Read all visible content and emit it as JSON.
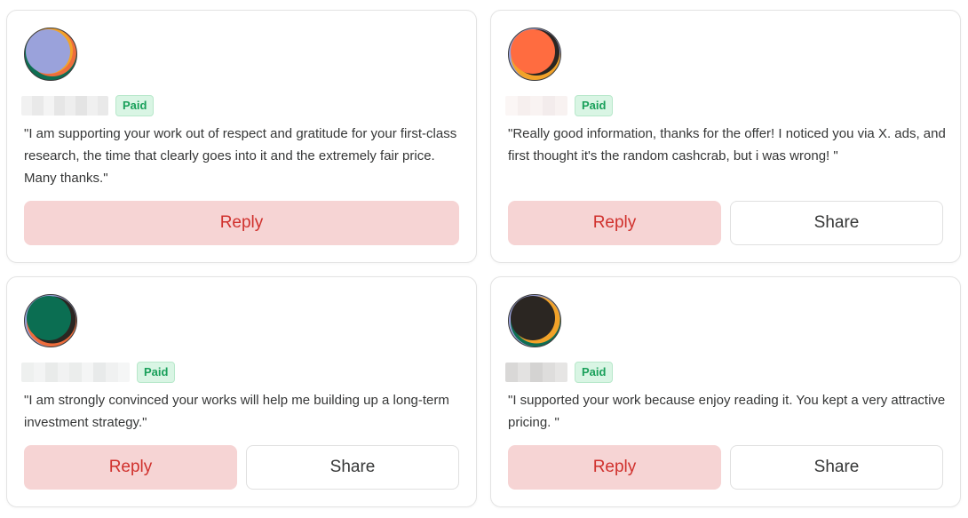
{
  "comments": [
    {
      "badge": "Paid",
      "quote": "\"I am supporting your work out of respect and gratitude for your first-class research, the time that clearly goes into it and the extremely fair price. Many thanks.\"",
      "reply_label": "Reply",
      "avatar_colors": {
        "front": "#9aa2db",
        "mid": "#f2a229",
        "back": "#ee6d3c",
        "base": "#0e6e52"
      }
    },
    {
      "badge": "Paid",
      "quote": "\"Really good information, thanks for the offer! I noticed you via X. ads, and first thought it's the random cashcrab, but i was wrong! \"",
      "reply_label": "Reply",
      "share_label": "Share",
      "avatar_colors": {
        "front": "#ff6c40",
        "mid": "#2b2622",
        "back": "#f2a229",
        "base": "#9aa2db"
      }
    },
    {
      "badge": "Paid",
      "quote": "\"I am strongly convinced your works will help me building up a long-term investment strategy.\"",
      "reply_label": "Reply",
      "share_label": "Share",
      "avatar_colors": {
        "front": "#0b6e52",
        "mid": "#2b2622",
        "back": "#ee6d3c",
        "base": "#9aa2db"
      }
    },
    {
      "badge": "Paid",
      "quote": "\"I supported your work because enjoy reading it. You kept a very attractive pricing. \"",
      "reply_label": "Reply",
      "share_label": "Share",
      "avatar_colors": {
        "front": "#2b2622",
        "mid": "#f2a229",
        "back": "#0e6e52",
        "base": "#9aa2db"
      }
    }
  ],
  "colors": {
    "paid_badge_bg": "#d9f5e4",
    "paid_badge_text": "#19a05a",
    "reply_bg": "#f6d4d4",
    "reply_text": "#d0312d"
  }
}
